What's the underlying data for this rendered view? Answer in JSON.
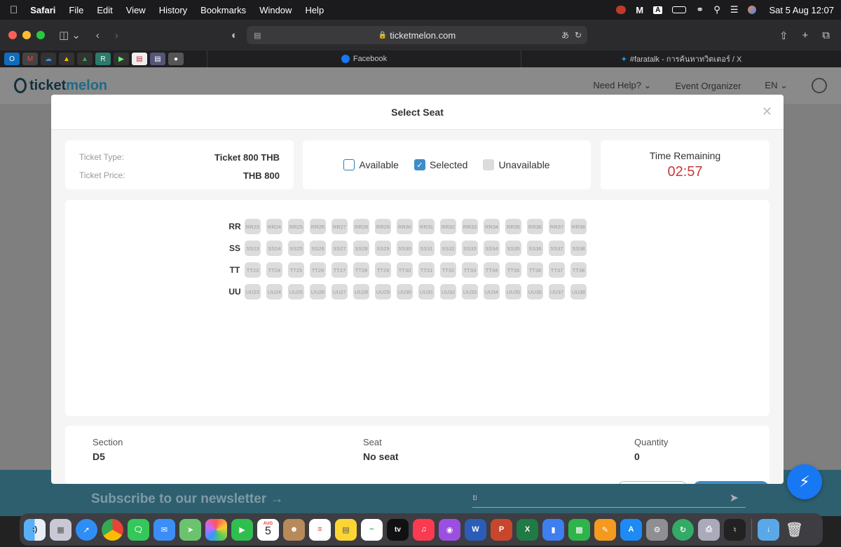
{
  "menubar": {
    "apple": "",
    "items": [
      "Safari",
      "File",
      "Edit",
      "View",
      "History",
      "Bookmarks",
      "Window",
      "Help"
    ],
    "clock": "Sat 5 Aug  12:07"
  },
  "browser": {
    "url": "ticketmelon.com",
    "tabs": [
      {
        "label": "Facebook"
      },
      {
        "label": "#faratalk - การค้นหาทวิตเตอร์ / X"
      }
    ]
  },
  "site": {
    "logo_prefix": "ticket",
    "logo_suffix": "melon",
    "nav": {
      "help": "Need Help? ⌄",
      "organizer": "Event Organizer",
      "lang": "EN ⌄"
    },
    "newsletter": "Subscribe to our newsletter →",
    "email_placeholder": "ย"
  },
  "modal": {
    "title": "Select Seat",
    "ticket": {
      "type_label": "Ticket Type:",
      "type_value": "Ticket 800 THB",
      "price_label": "Ticket Price:",
      "price_value": "THB 800"
    },
    "legend": {
      "available": "Available",
      "selected": "Selected",
      "unavailable": "Unavailable"
    },
    "timer": {
      "label": "Time Remaining",
      "value": "02:57"
    },
    "rows": [
      {
        "label": "RR",
        "seats": [
          "RR23",
          "RR24",
          "RR25",
          "RR26",
          "RR27",
          "RR28",
          "RR29",
          "RR30",
          "RR31",
          "RR32",
          "RR33",
          "RR34",
          "RR35",
          "RR36",
          "RR37",
          "RR38"
        ]
      },
      {
        "label": "SS",
        "seats": [
          "SS23",
          "SS24",
          "SS25",
          "SS26",
          "SS27",
          "SS28",
          "SS29",
          "SS30",
          "SS31",
          "SS32",
          "SS33",
          "SS34",
          "SS35",
          "SS36",
          "SS37",
          "SS38"
        ]
      },
      {
        "label": "TT",
        "seats": [
          "TT23",
          "TT24",
          "TT25",
          "TT26",
          "TT27",
          "TT28",
          "TT29",
          "TT30",
          "TT31",
          "TT32",
          "TT33",
          "TT34",
          "TT35",
          "TT36",
          "TT37",
          "TT38"
        ]
      },
      {
        "label": "UU",
        "seats": [
          "UU23",
          "UU24",
          "UU25",
          "UU26",
          "UU27",
          "UU28",
          "UU29",
          "UU30",
          "UU31",
          "UU32",
          "UU33",
          "UU34",
          "UU35",
          "UU36",
          "UU37",
          "UU38"
        ]
      }
    ],
    "summary": {
      "section_label": "Section",
      "section_value": "D5",
      "seat_label": "Seat",
      "seat_value": "No seat",
      "quantity_label": "Quantity",
      "quantity_value": "0"
    }
  },
  "dock": {
    "calendar_month": "AUG",
    "calendar_day": "5"
  },
  "colors": {
    "accent": "#3c8dc9",
    "timer": "#c63a3a",
    "footer": "#2e5f6e",
    "messenger": "#1877f2"
  }
}
